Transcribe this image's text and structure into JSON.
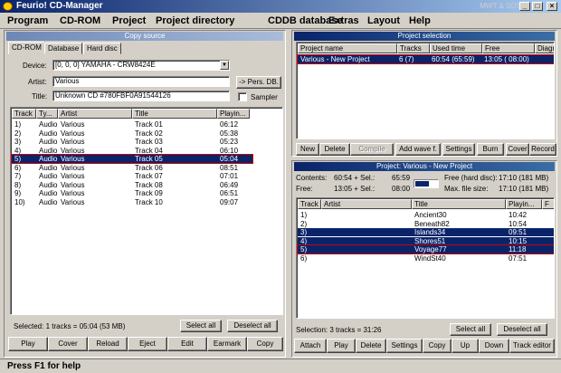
{
  "window": {
    "title": "Feurio! CD-Manager",
    "title_extra": "MWT & SOS"
  },
  "menu": [
    "Program",
    "CD-ROM",
    "Project",
    "Project directory",
    "CDDB database",
    "Extras",
    "Layout",
    "Help"
  ],
  "copy_source": {
    "caption": "Copy source",
    "tabs": [
      "CD-ROM",
      "Database",
      "Hard disc"
    ],
    "device_label": "Device:",
    "device_value": "[0, 0, 0]  YAMAHA - CRW8424E",
    "artist_label": "Artist:",
    "artist_value": "Various",
    "title_label": "Title:",
    "title_value": "Unknown CD #780FBF0A91544126",
    "pers_db_button": "-> Pers. DB.",
    "sampler_label": "Sampler",
    "columns": [
      "Track",
      "Ty...",
      "Artist",
      "Title",
      "Playin..."
    ],
    "tracks": [
      {
        "track": "1)",
        "type": "Audio",
        "artist": "Various",
        "title": "Track 01",
        "time": "06:12"
      },
      {
        "track": "2)",
        "type": "Audio",
        "artist": "Various",
        "title": "Track 02",
        "time": "05:38"
      },
      {
        "track": "3)",
        "type": "Audio",
        "artist": "Various",
        "title": "Track 03",
        "time": "05:23"
      },
      {
        "track": "4)",
        "type": "Audio",
        "artist": "Various",
        "title": "Track 04",
        "time": "06:10"
      },
      {
        "track": "5)",
        "type": "Audio",
        "artist": "Various",
        "title": "Track 05",
        "time": "05:04"
      },
      {
        "track": "6)",
        "type": "Audio",
        "artist": "Various",
        "title": "Track 06",
        "time": "08:51"
      },
      {
        "track": "7)",
        "type": "Audio",
        "artist": "Various",
        "title": "Track 07",
        "time": "07:01"
      },
      {
        "track": "8)",
        "type": "Audio",
        "artist": "Various",
        "title": "Track 08",
        "time": "06:49"
      },
      {
        "track": "9)",
        "type": "Audio",
        "artist": "Various",
        "title": "Track 09",
        "time": "06:51"
      },
      {
        "track": "10)",
        "type": "Audio",
        "artist": "Various",
        "title": "Track 10",
        "time": "09:07"
      }
    ],
    "selected_track_index": 4,
    "status": "Selected: 1 tracks = 05:04 (53 MB)",
    "select_all": "Select all",
    "deselect_all": "Deselect all",
    "buttons": [
      "Play",
      "Cover",
      "Reload",
      "Eject",
      "Edit",
      "Earmark",
      "Copy"
    ]
  },
  "project_selection": {
    "caption": "Project selection",
    "columns": [
      "Project name",
      "Tracks",
      "Used time",
      "Free",
      "Diagra..."
    ],
    "rows": [
      {
        "name": "Various - New Project",
        "tracks": "6 (7)",
        "used": "60:54 (65:59)",
        "free": "13:05 ( 08:00)"
      }
    ],
    "buttons": [
      "New",
      "Delete",
      "Compile",
      "Add wave f.",
      "Settings",
      "Burn",
      "Cover",
      "Record"
    ]
  },
  "project": {
    "caption": "Project: Various - New Project",
    "contents_label": "Contents:",
    "contents_value": "60:54 + Sel.:",
    "contents_sel": "65:59",
    "free_label": "Free:",
    "free_value": "13:05 + Sel.:",
    "free_sel": "08:00",
    "free_hd_label": "Free (hard disc):",
    "free_hd_value": "17:10 (181 MB)",
    "max_file_label": "Max. file size:",
    "max_file_value": "17:10 (181 MB)",
    "progress_fraction": 0.62,
    "columns": [
      "Track",
      "Artist",
      "Title",
      "Playin...",
      "F"
    ],
    "tracks": [
      {
        "track": "1)",
        "title": "Ancient30",
        "time": "10:42"
      },
      {
        "track": "2)",
        "title": "Beneath82",
        "time": "10:54"
      },
      {
        "track": "3)",
        "title": "Islands34",
        "time": "09:51"
      },
      {
        "track": "4)",
        "title": "Shores51",
        "time": "10:15"
      },
      {
        "track": "5)",
        "title": "Voyage77",
        "time": "11:18"
      },
      {
        "track": "6)",
        "title": "WindSt40",
        "time": "07:51"
      }
    ],
    "selected_indices": [
      2,
      3,
      4
    ],
    "status": "Selection: 3 tracks = 31:26",
    "select_all": "Select all",
    "deselect_all": "Deselect all",
    "buttons": [
      "Attach",
      "Play",
      "Delete",
      "Settings",
      "Copy",
      "Up",
      "Down",
      "Track editor"
    ]
  },
  "statusbar": {
    "text": "Press F1 for help"
  }
}
